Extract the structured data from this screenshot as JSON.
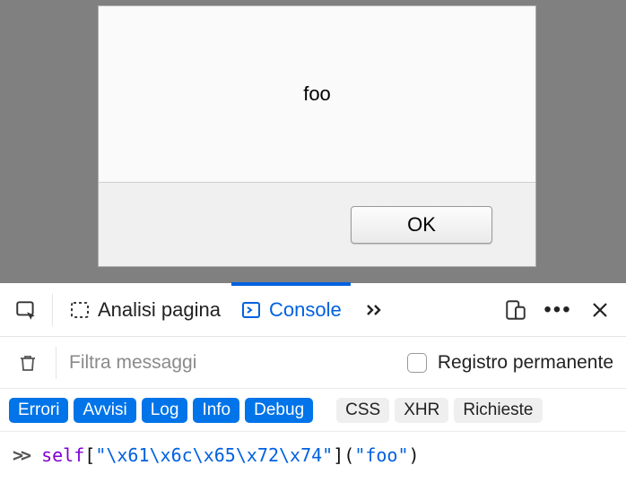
{
  "alert": {
    "message": "foo",
    "ok_label": "OK"
  },
  "toolbar": {
    "tab_inspector": "Analisi pagina",
    "tab_console": "Console"
  },
  "filter": {
    "placeholder": "Filtra messaggi",
    "persist_label": "Registro permanente"
  },
  "categories": {
    "errors": "Errori",
    "warnings": "Avvisi",
    "log": "Log",
    "info": "Info",
    "debug": "Debug",
    "css": "CSS",
    "xhr": "XHR",
    "requests": "Richieste"
  },
  "console": {
    "token_self": "self",
    "token_open_br": "[",
    "token_key": "\"\\x61\\x6c\\x65\\x72\\x74\"",
    "token_close_br": "]",
    "token_open_paren": "(",
    "token_arg": "\"foo\"",
    "token_close_paren": ")"
  }
}
